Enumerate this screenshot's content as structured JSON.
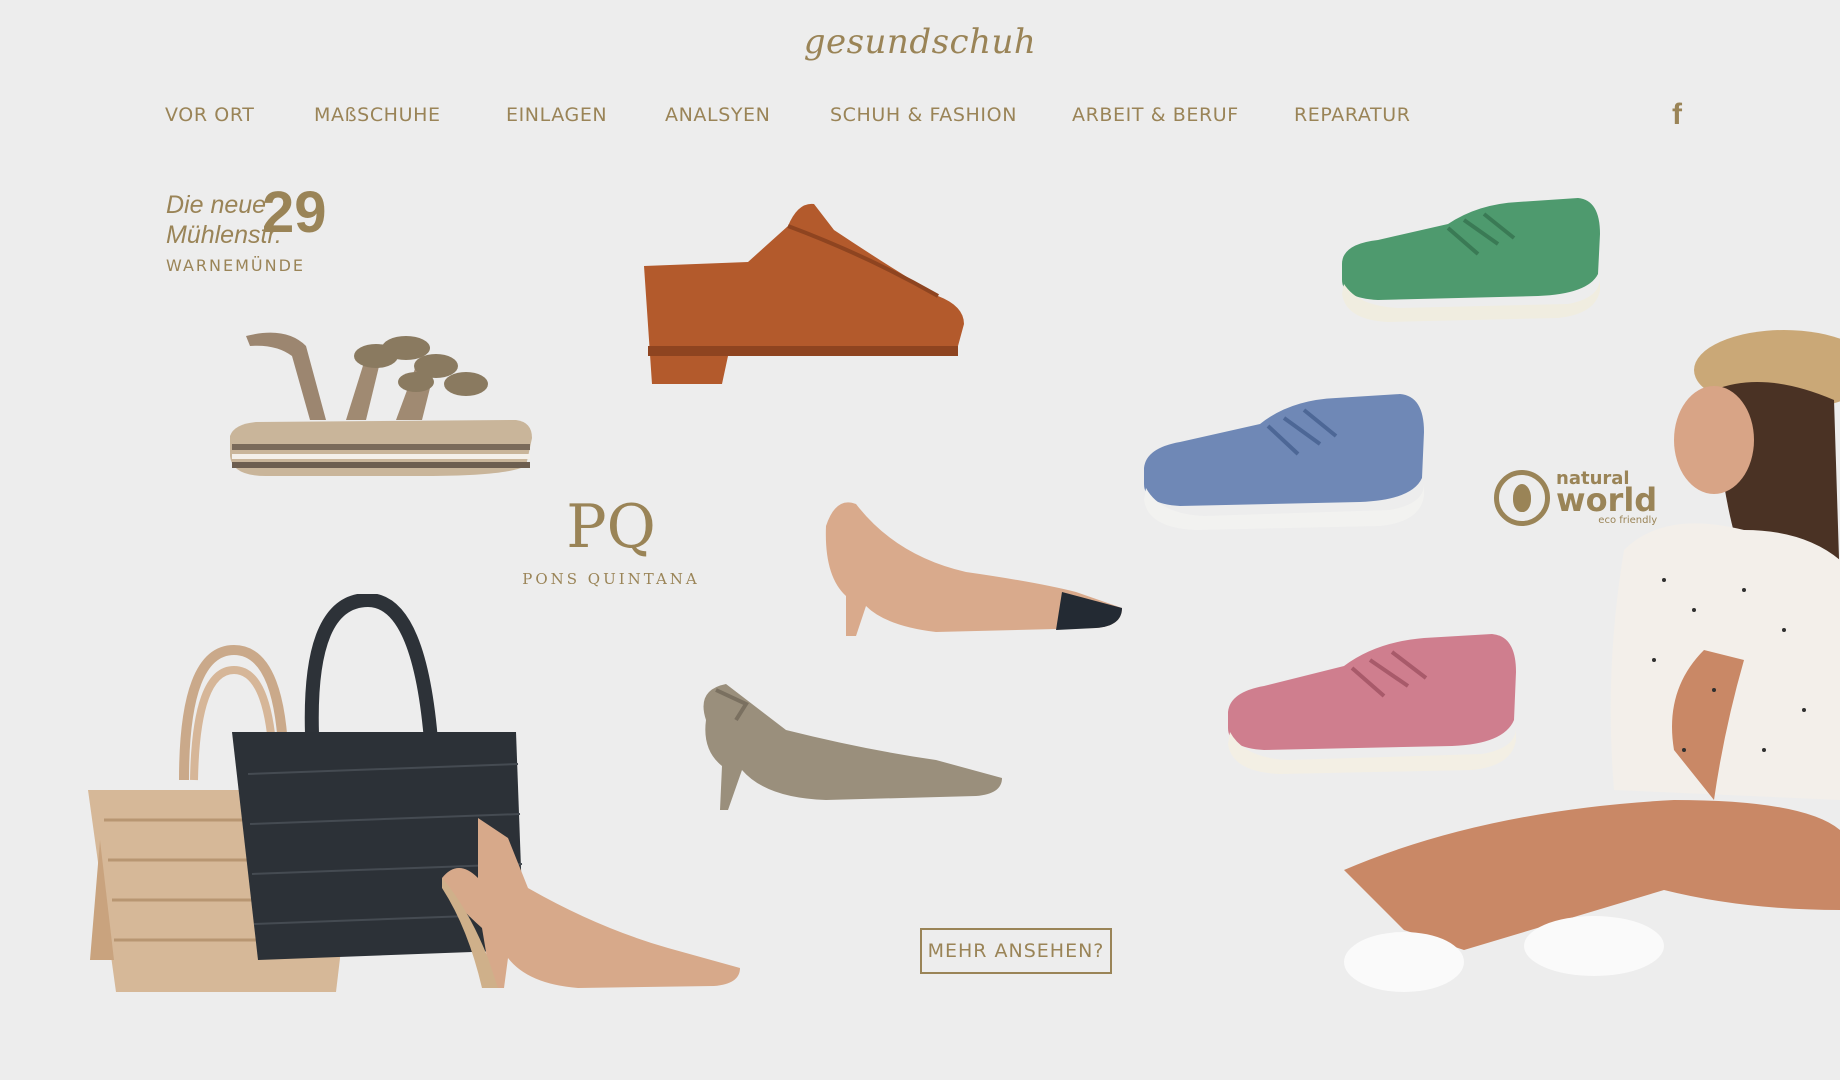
{
  "header": {
    "logo_text": "gesundschuh",
    "nav": [
      {
        "label": "VOR ORT"
      },
      {
        "label": "MAßSCHUHE"
      },
      {
        "label": "EINLAGEN"
      },
      {
        "label": "ANALSYEN"
      },
      {
        "label": "SCHUH & FASHION"
      },
      {
        "label": "ARBEIT & BERUF"
      },
      {
        "label": "REPARATUR"
      }
    ],
    "social_icon": "facebook-icon",
    "social_glyph": "f"
  },
  "badge": {
    "line1": "Die neue",
    "line2": "Mühlenstr.",
    "number": "29",
    "town": "WARNEMÜNDE"
  },
  "brands": {
    "pons_quintana": {
      "monogram": "PQ",
      "name": "PONS QUINTANA"
    },
    "natural_world": {
      "line1": "natural",
      "line2": "world",
      "tagline": "eco friendly"
    }
  },
  "cta": {
    "label": "MEHR ANSEHEN?"
  },
  "colors": {
    "background": "#ededed",
    "accent": "#9a8457"
  }
}
